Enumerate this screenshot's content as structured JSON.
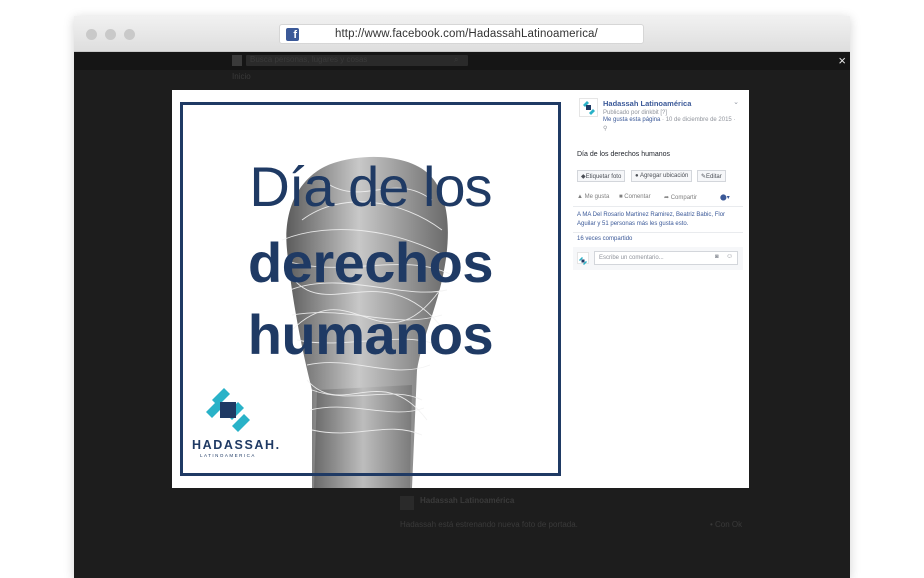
{
  "browser": {
    "url": "http://www.facebook.com/HadassahLatinoamerica/",
    "fb_letter": "f",
    "colors": {
      "frame": "#e6e6e6",
      "background": "#1d1d1d",
      "fb_blue": "#3b5998"
    }
  },
  "fb_header": {
    "search_placeholder": "Busca personas, lugares y cosas",
    "profile_link": "Inicio",
    "close_symbol": "×"
  },
  "photo": {
    "title_line1": "Día de los",
    "title_line2": "derechos",
    "title_line3": "humanos",
    "logo_name": "HADASSAH.",
    "logo_sub": "LATINOAMERICA",
    "brand_color": "#1f3a64",
    "accent_color": "#29b2c8"
  },
  "post": {
    "page_name": "Hadassah Latinoamérica",
    "published_by": "Publicado por dinkbit [?]",
    "like_page": "Me gusta esta página",
    "date": "· 10 de diciembre de 2015 ·",
    "caption": "Día de los derechos humanos",
    "buttons": {
      "tag_photo": "Etiquetar foto",
      "add_location": "Agregar ubicación",
      "edit": "Editar"
    },
    "actions": {
      "like": "Me gusta",
      "comment": "Comentar",
      "share": "Compartir"
    },
    "likes_text": "A MA Del Rosario Martinez Ramirez, Beatriz Babic, Flor Aguilar y 51 personas más les gusta esto.",
    "shares_text": "16 veces compartido",
    "comment_placeholder": "Escribe un comentario..."
  },
  "background_feed": {
    "post_author": "Hadassah Latinoamérica",
    "post_text": "Hadassah está estrenando nueva foto de portada.",
    "side_text": "• Con Ok"
  }
}
